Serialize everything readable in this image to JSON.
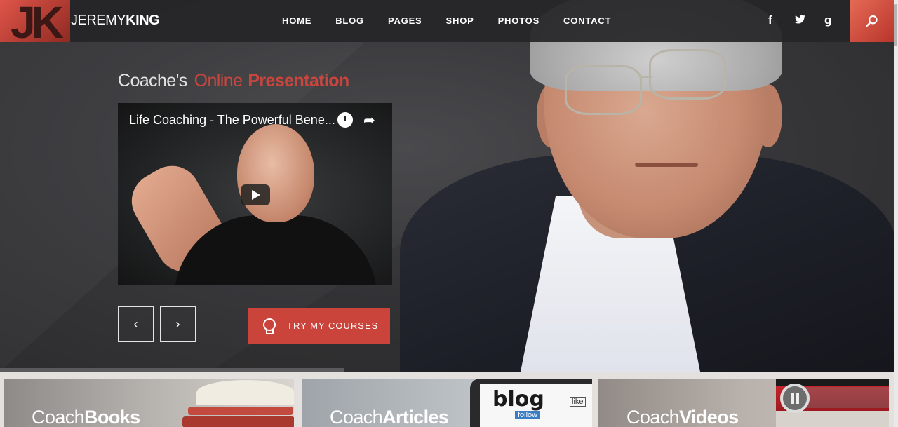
{
  "brand": {
    "mark": "JK",
    "name_light": "JEREMY",
    "name_bold": "KING"
  },
  "nav": [
    "HOME",
    "BLOG",
    "PAGES",
    "SHOP",
    "PHOTOS",
    "CONTACT"
  ],
  "social": [
    {
      "icon": "facebook-icon",
      "glyph": "f"
    },
    {
      "icon": "twitter-icon",
      "glyph": "t"
    },
    {
      "icon": "google-icon",
      "glyph": "g"
    }
  ],
  "search": {
    "icon": "search-icon"
  },
  "headline": {
    "w1": "Coache's",
    "w2": "Online",
    "w3": "Presentation"
  },
  "video": {
    "title": "Life Coaching - The Powerful Bene..."
  },
  "controls": {
    "prev": "‹",
    "next": "›",
    "cta": "TRY MY COURSES"
  },
  "cards": [
    {
      "light": "Coach",
      "bold": "Books"
    },
    {
      "light": "Coach",
      "bold": "Articles"
    },
    {
      "light": "Coach",
      "bold": "Videos"
    }
  ],
  "card_art": {
    "blog_word": "blog",
    "follow_word": "follow",
    "like_word": "like"
  },
  "colors": {
    "accent": "#cb443c",
    "header_bg": "#262628",
    "hero_bg": "#38383b"
  }
}
